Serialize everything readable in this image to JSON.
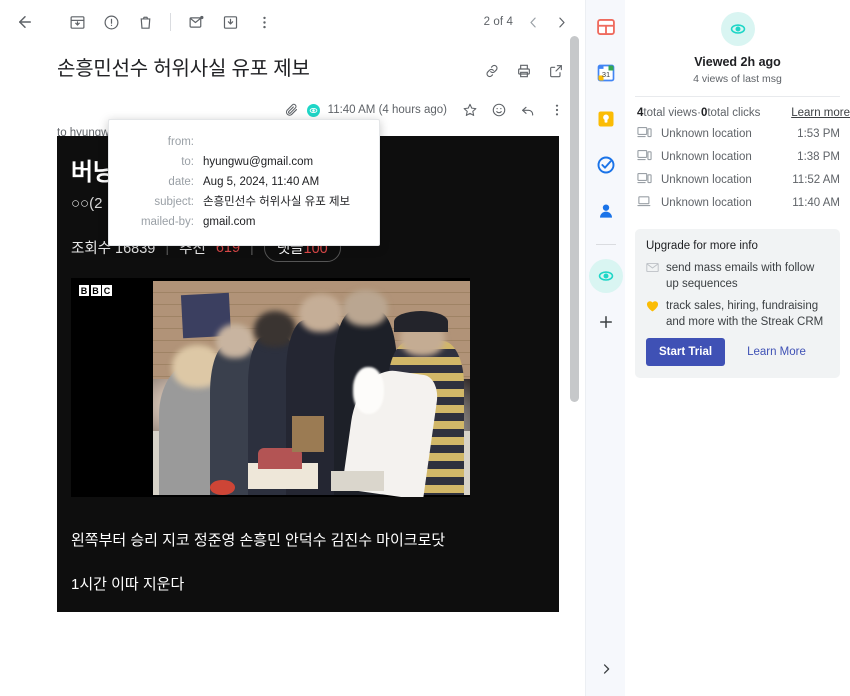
{
  "toolbar": {
    "back_label": "Back",
    "archive_label": "Archive",
    "spam_label": "Report spam",
    "delete_label": "Delete",
    "unread_label": "Mark as unread",
    "snooze_label": "Move to Inbox",
    "more_label": "More",
    "pager_count": "2 of 4",
    "prev_label": "Older",
    "next_label": "Newer"
  },
  "message": {
    "subject": "손흥민선수 허위사실 유포 제보",
    "link_label": "Copy link",
    "print_label": "Print",
    "popout_label": "Open in new window",
    "time": "11:40 AM (4 hours ago)",
    "star_label": "Star",
    "emoji_label": "Add emoji reaction",
    "reply_label": "Reply",
    "more_label": "More",
    "recipient": "to hyungwu"
  },
  "details_tooltip": {
    "rows": [
      {
        "key": "from:",
        "value": ""
      },
      {
        "key": "to:",
        "value": "hyungwu@gmail.com"
      },
      {
        "key": "date:",
        "value": "Aug 5, 2024, 11:40 AM"
      },
      {
        "key": "subject:",
        "value": "손흥민선수 허위사실 유포 제보"
      },
      {
        "key": "mailed-by:",
        "value": "gmail.com"
      }
    ]
  },
  "body": {
    "title": "버닝썬",
    "subtitle": "○○(2",
    "stats": {
      "views_label": "조회수 16839",
      "sep1": "|",
      "likes_label": "추천",
      "likes_value": "619",
      "sep2": "|",
      "comments_label": "댓글",
      "comments_value": "100"
    },
    "image_watermark": [
      "B",
      "B",
      "C"
    ],
    "caption": "왼쪽부터 승리 지코 정준영 손흥민 안덕수 김진수 마이크로닷",
    "caption2": "1시간 이따 지운다"
  },
  "rail": {
    "items": [
      {
        "name": "streak-icon",
        "label": "Streak"
      },
      {
        "name": "calendar-icon",
        "label": "Calendar"
      },
      {
        "name": "keep-icon",
        "label": "Keep"
      },
      {
        "name": "tasks-icon",
        "label": "Tasks"
      },
      {
        "name": "contacts-icon",
        "label": "Contacts"
      }
    ],
    "active_label": "Streak email tracking",
    "add_label": "Get add-ons",
    "collapse_label": "Hide side panel"
  },
  "panel": {
    "hero_title": "Viewed 2h ago",
    "hero_sub": "4 views of last msg",
    "totals_views_num": "4",
    "totals_views_text": " total views ",
    "totals_dot": "· ",
    "totals_clicks_num": "0",
    "totals_clicks_text": " total clicks",
    "learn_more": "Learn more",
    "views": [
      {
        "device": "desktop-mobile-icon",
        "location": "Unknown location",
        "time": "1:53 PM"
      },
      {
        "device": "desktop-mobile-icon",
        "location": "Unknown location",
        "time": "1:38 PM"
      },
      {
        "device": "desktop-mobile-icon",
        "location": "Unknown location",
        "time": "11:52 AM"
      },
      {
        "device": "laptop-icon",
        "location": "Unknown location",
        "time": "11:40 AM"
      }
    ],
    "promo": {
      "title": "Upgrade for more info",
      "item1": "send mass emails with follow up sequences",
      "item2": "track sales, hiring, fundraising and more with the Streak CRM",
      "start_trial": "Start Trial",
      "learn_more": "Learn More"
    }
  },
  "colors": {
    "accent_teal": "#1ed6c7",
    "accent_blue": "#1a73e8",
    "promo_button": "#3f51b5",
    "stat_red": "#e04a4a"
  }
}
